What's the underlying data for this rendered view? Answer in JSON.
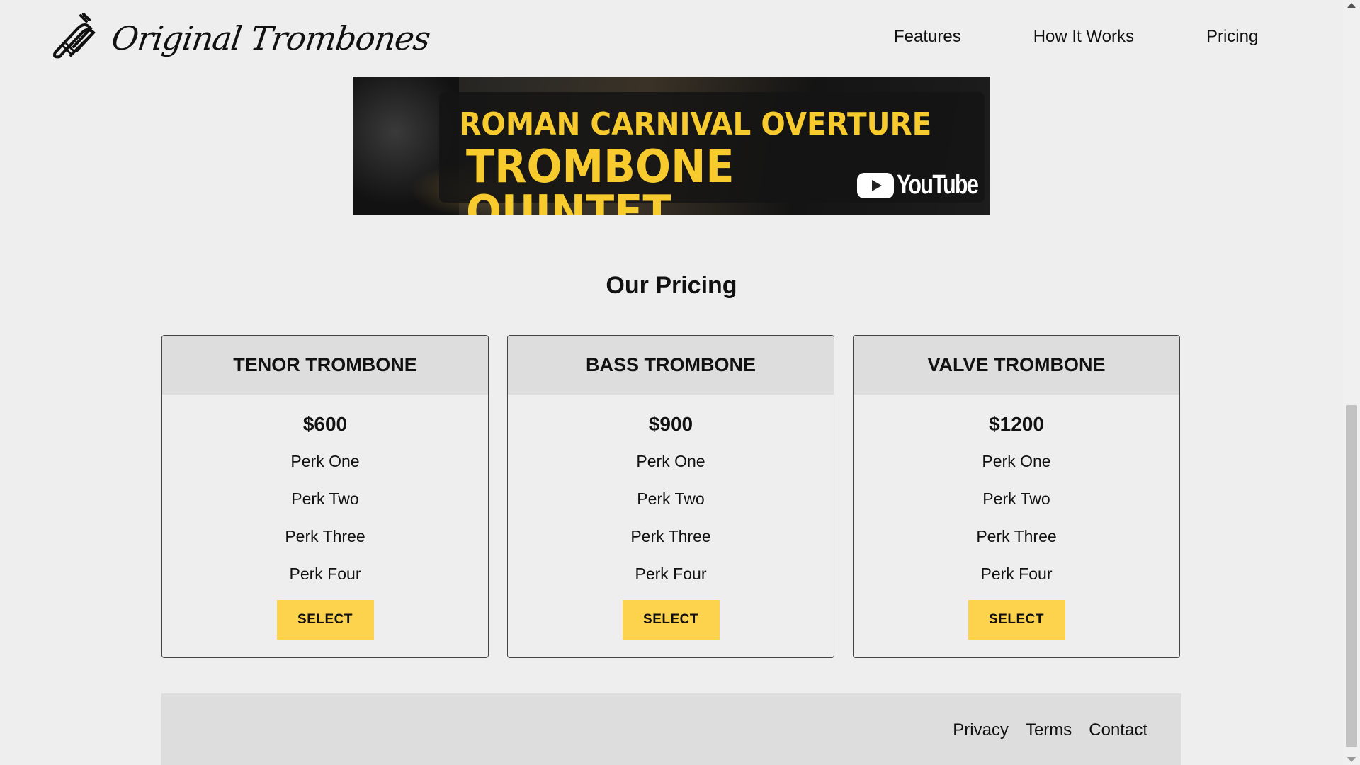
{
  "header": {
    "brand": "Original Trombones",
    "logo_icon": "trombone-icon",
    "nav": [
      "Features",
      "How It Works",
      "Pricing"
    ]
  },
  "video": {
    "line1": "ROMAN CARNIVAL OVERTURE",
    "line2": "TROMBONE QUINTET",
    "platform": "YouTube"
  },
  "pricing": {
    "title": "Our Pricing",
    "plans": [
      {
        "name": "TENOR TROMBONE",
        "price": "$600",
        "perks": [
          "Perk One",
          "Perk Two",
          "Perk Three",
          "Perk Four"
        ],
        "button": "SELECT"
      },
      {
        "name": "BASS TROMBONE",
        "price": "$900",
        "perks": [
          "Perk One",
          "Perk Two",
          "Perk Three",
          "Perk Four"
        ],
        "button": "SELECT"
      },
      {
        "name": "VALVE TROMBONE",
        "price": "$1200",
        "perks": [
          "Perk One",
          "Perk Two",
          "Perk Three",
          "Perk Four"
        ],
        "button": "SELECT"
      }
    ]
  },
  "footer": {
    "links": [
      "Privacy",
      "Terms",
      "Contact"
    ]
  },
  "colors": {
    "background": "#eeeeee",
    "accent": "#fdd34d",
    "panel": "#dddddd",
    "video_text": "#f7cb2d"
  }
}
